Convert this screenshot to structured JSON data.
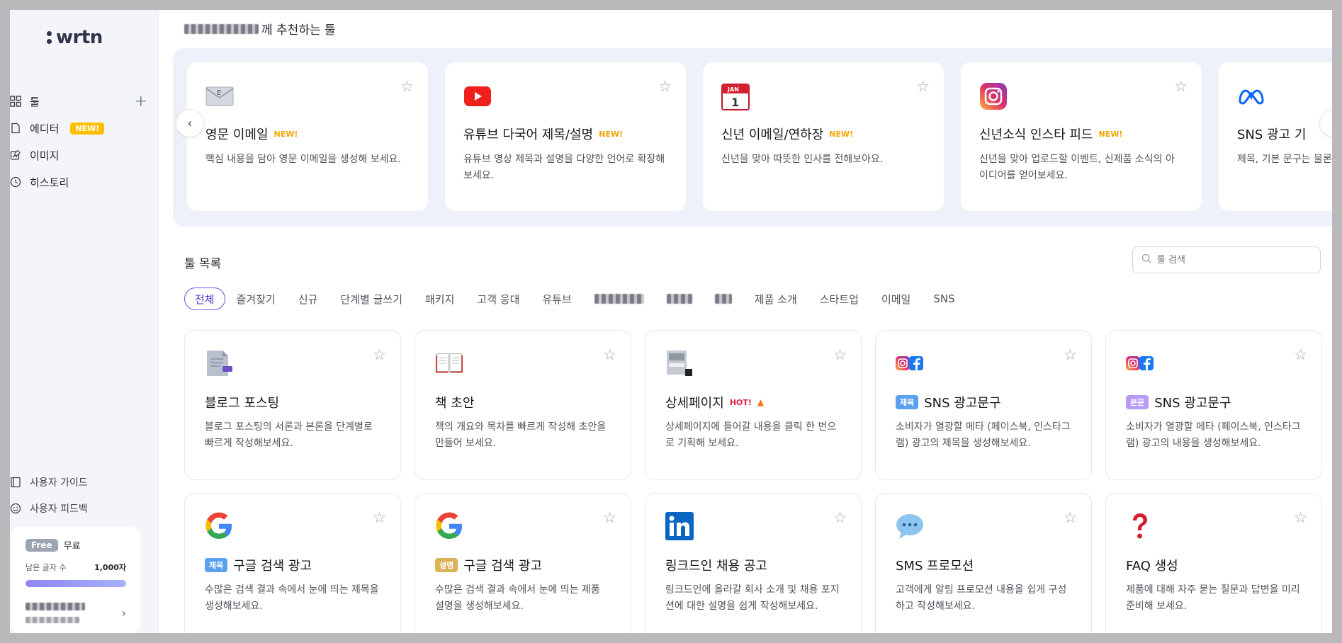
{
  "sidebar": {
    "logo": "wrtn",
    "nav": [
      {
        "label": "툴",
        "icon": "grid-icon"
      },
      {
        "label": "에디터",
        "icon": "document-icon",
        "badge": "NEW!"
      },
      {
        "label": "이미지",
        "icon": "image-edit-icon"
      },
      {
        "label": "히스토리",
        "icon": "clock-icon"
      }
    ],
    "add_symbol": "+",
    "bottom_links": [
      {
        "label": "사용자 가이드",
        "icon": "book-icon"
      },
      {
        "label": "사용자 피드백",
        "icon": "smile-icon"
      }
    ],
    "plan": {
      "badge": "Free",
      "name": "무료",
      "remaining_label": "남은 글자 수",
      "remaining_value": "1,000자",
      "progress_fraction": 1.0
    }
  },
  "recommend": {
    "title_suffix": "께 추천하는 툴",
    "cards": [
      {
        "title": "영문 이메일",
        "tag": "NEW!",
        "desc": "핵심 내용을 담아 영문 이메일을 생성해 보세요.",
        "icon": "envelope-icon"
      },
      {
        "title": "유튜브 다국어 제목/설명",
        "tag": "NEW!",
        "desc": "유튜브 영상 제목과 설명을 다양한 언어로 확장해보세요.",
        "icon": "youtube-icon"
      },
      {
        "title": "신년 이메일/연하장",
        "tag": "NEW!",
        "desc": "신년을 맞아 따뜻한 인사를 전해보아요.",
        "icon": "calendar-icon"
      },
      {
        "title": "신년소식 인스타 피드",
        "tag": "NEW!",
        "desc": "신년을 맞아 업로드할 이벤트, 신제품 소식의 아이디어를 얻어보세요.",
        "icon": "instagram-icon"
      },
      {
        "title": "SNS 광고 기",
        "tag": "",
        "desc": "제목, 기본 문구는 물론 까지 한 번에!",
        "icon": "meta-icon"
      }
    ]
  },
  "tool_list": {
    "title": "툴 목록",
    "search_placeholder": "툴 검색",
    "tabs": [
      "전체",
      "즐겨찾기",
      "신규",
      "단계별 글쓰기",
      "패키지",
      "고객 응대",
      "유튜브",
      "",
      "",
      "",
      "제품 소개",
      "스타트업",
      "이메일",
      "SNS"
    ],
    "active_tab": 0,
    "cards": [
      {
        "title": "블로그 포스팅",
        "chip": "",
        "tag": "",
        "desc": "블로그 포스팅의 서론과 본론을 단계별로 빠르게 작성해보세요.",
        "icon": "document-pen-icon"
      },
      {
        "title": "책 초안",
        "chip": "",
        "tag": "",
        "desc": "책의 개요와 목차를 빠르게 작성해 초안을 만들어 보세요.",
        "icon": "open-book-icon"
      },
      {
        "title": "상세페이지",
        "chip": "",
        "tag": "HOT!",
        "desc": "상세페이지에 들어갈 내용을 클릭 한 번으로 기획해 보세요.",
        "icon": "page-layout-icon"
      },
      {
        "title": "SNS 광고문구",
        "chip": "제목",
        "tag": "",
        "desc": "소비자가 열광할 메타 (페이스북, 인스타그램) 광고의 제목을 생성해보세요.",
        "icon": "instagram-facebook-icon"
      },
      {
        "title": "SNS 광고문구",
        "chip": "본문",
        "tag": "",
        "desc": "소비자가 열광할 메타 (페이스북, 인스타그램) 광고의 내용을 생성해보세요.",
        "icon": "instagram-facebook-icon"
      },
      {
        "title": "구글 검색 광고",
        "chip": "제목",
        "tag": "",
        "desc": "수많은 검색 결과 속에서 눈에 띄는 제목을 생성해보세요.",
        "icon": "google-icon"
      },
      {
        "title": "구글 검색 광고",
        "chip": "설명",
        "tag": "",
        "desc": "수많은 검색 결과 속에서 눈에 띄는 제품 설명을 생성해보세요.",
        "icon": "google-icon"
      },
      {
        "title": "링크드인 채용 공고",
        "chip": "",
        "tag": "",
        "desc": "링크드인에 올라갈 회사 소개 및 채용 포지션에 대한 설명을 쉽게 작성해보세요.",
        "icon": "linkedin-icon"
      },
      {
        "title": "SMS 프로모션",
        "chip": "",
        "tag": "",
        "desc": "고객에게 알림 프로모션 내용을 쉽게 구성하고 작성해보세요.",
        "icon": "speech-bubble-icon"
      },
      {
        "title": "FAQ 생성",
        "chip": "",
        "tag": "",
        "desc": "제품에 대해 자주 묻는 질문과 답변을 미리 준비해 보세요.",
        "icon": "question-mark-icon"
      }
    ]
  },
  "colors": {
    "accent": "#6d4ef5",
    "new_tag": "#f3a500",
    "hot_tag": "#e11d48",
    "chip_title": "#5aa0f0",
    "chip_body": "#b69af5",
    "chip_desc": "#d9b25a"
  }
}
